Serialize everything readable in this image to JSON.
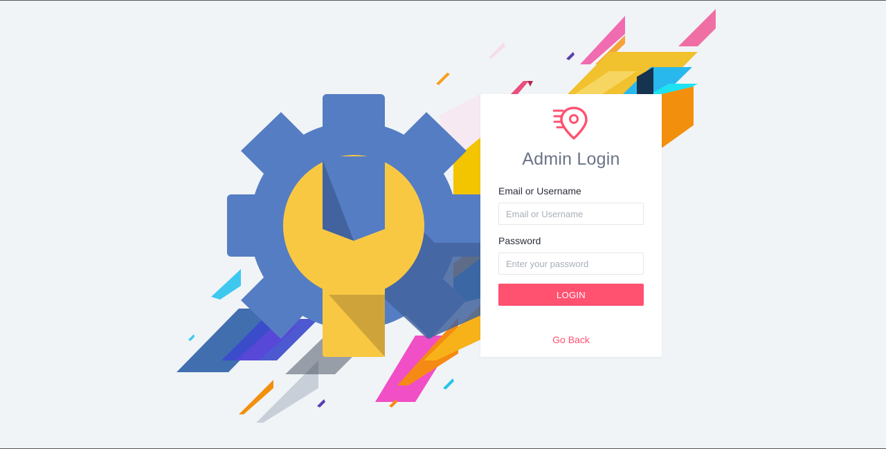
{
  "login": {
    "title": "Admin Login",
    "email_label": "Email or Username",
    "email_placeholder": "Email or Username",
    "email_value": "",
    "password_label": "Password",
    "password_placeholder": "Enter your password",
    "password_value": "",
    "submit_label": "LOGIN",
    "back_link": "Go Back"
  },
  "icons": {
    "logo": "map-pin-speed-icon",
    "illustration": "gear-wrench-icon"
  },
  "colors": {
    "accent": "#ff5170",
    "page_background": "#f0f4f7",
    "card_background": "#ffffff",
    "gear": "#557dc3",
    "gear_shadow": "#43639e",
    "wrench": "#f9c843",
    "wrench_shadow": "#c9a03a",
    "title_text": "#6b7385"
  }
}
